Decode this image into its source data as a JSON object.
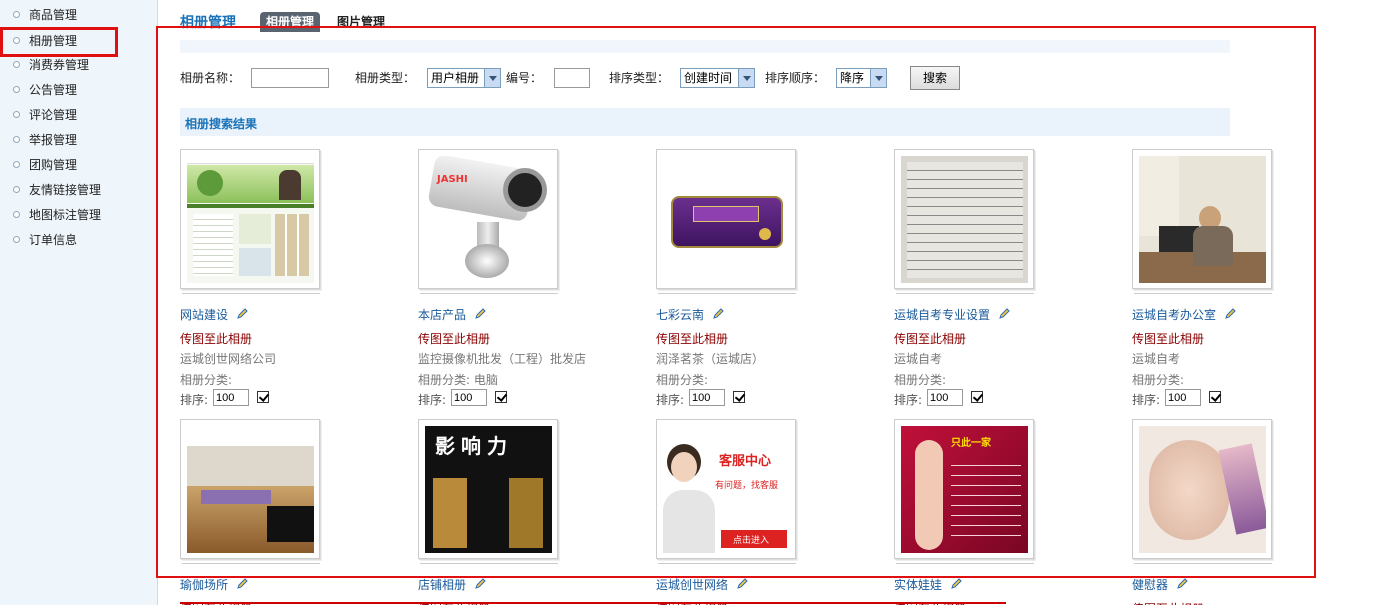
{
  "sidebar": {
    "items": [
      {
        "label": "商品管理"
      },
      {
        "label": "相册管理"
      },
      {
        "label": "消费券管理"
      },
      {
        "label": "公告管理"
      },
      {
        "label": "评论管理"
      },
      {
        "label": "举报管理"
      },
      {
        "label": "团购管理"
      },
      {
        "label": "友情链接管理"
      },
      {
        "label": "地图标注管理"
      },
      {
        "label": "订单信息"
      }
    ]
  },
  "header": {
    "title": "相册管理",
    "tabs": [
      {
        "label": "相册管理"
      },
      {
        "label": "图片管理"
      }
    ]
  },
  "search": {
    "name_label": "相册名称：",
    "name_value": "",
    "type_label": "相册类型：",
    "type_value": "用户相册",
    "id_label": "编号：",
    "id_value": "",
    "sort_type_label": "排序类型：",
    "sort_type_value": "创建时间",
    "sort_order_label": "排序顺序：",
    "sort_order_value": "降序",
    "button_label": "搜索"
  },
  "results": {
    "title": "相册搜索结果",
    "upload_label": "传图至此相册",
    "category_prefix": "相册分类:",
    "sort_label": "排序:",
    "albums": [
      {
        "name": "网站建设",
        "owner": "运城创世网络公司",
        "category": "相册分类:",
        "sort": "100"
      },
      {
        "name": "本店产品",
        "owner": "监控摄像机批发（工程）批发店",
        "category": "相册分类: 电脑",
        "sort": "100"
      },
      {
        "name": "七彩云南",
        "owner": "润泽茗茶（运城店）",
        "category": "相册分类:",
        "sort": "100"
      },
      {
        "name": "运城自考专业设置",
        "owner": "运城自考",
        "category": "相册分类:",
        "sort": "100"
      },
      {
        "name": "运城自考办公室",
        "owner": "运城自考",
        "category": "相册分类:",
        "sort": "100"
      },
      {
        "name": "瑜伽场所",
        "owner": "",
        "category": "",
        "sort": ""
      },
      {
        "name": "店铺相册",
        "owner": "",
        "category": "",
        "sort": ""
      },
      {
        "name": "运城创世网络",
        "owner": "",
        "category": "",
        "sort": ""
      },
      {
        "name": "实体娃娃",
        "owner": "",
        "category": "",
        "sort": ""
      },
      {
        "name": "健慰器",
        "owner": "",
        "category": "",
        "sort": ""
      }
    ],
    "thumb_texts": {
      "brand": "JASHI",
      "sign": "影响力",
      "service_title": "客服中心",
      "service_sub": "有问题，找客服",
      "service_btn": "点击进入",
      "promo": "只此一家"
    }
  },
  "colors": {
    "accent": "#1a73b8",
    "highlight_red": "#e01010",
    "upload_text": "#8b0000"
  }
}
